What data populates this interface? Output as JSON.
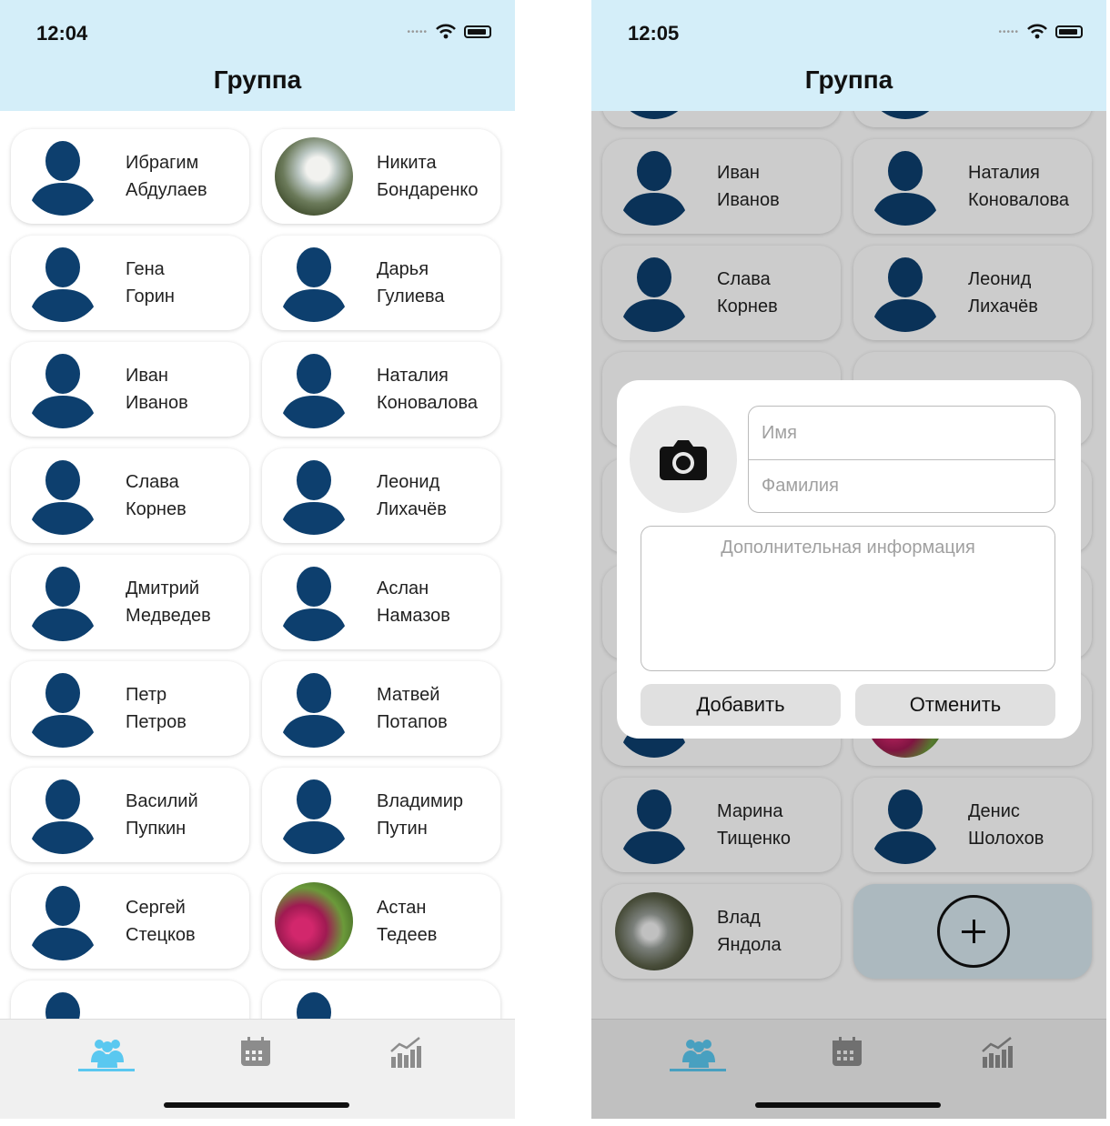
{
  "status": {
    "left_time": "12:04",
    "right_time": "12:05"
  },
  "header": {
    "title": "Группа"
  },
  "left_students": [
    {
      "first": "Ибрагим",
      "last": "Абдулаев",
      "avatar": "person-icon"
    },
    {
      "first": "Никита",
      "last": "Бондаренко",
      "avatar": "photo-waterfall"
    },
    {
      "first": "Гена",
      "last": "Горин",
      "avatar": "person-icon"
    },
    {
      "first": "Дарья",
      "last": "Гулиева",
      "avatar": "person-icon"
    },
    {
      "first": "Иван",
      "last": "Иванов",
      "avatar": "person-icon"
    },
    {
      "first": "Наталия",
      "last": "Коновалова",
      "avatar": "person-icon"
    },
    {
      "first": "Слава",
      "last": "Корнев",
      "avatar": "person-icon"
    },
    {
      "first": "Леонид",
      "last": "Лихачёв",
      "avatar": "person-icon"
    },
    {
      "first": "Дмитрий",
      "last": "Медведев",
      "avatar": "person-icon"
    },
    {
      "first": "Аслан",
      "last": "Намазов",
      "avatar": "person-icon"
    },
    {
      "first": "Петр",
      "last": "Петров",
      "avatar": "person-icon"
    },
    {
      "first": "Матвей",
      "last": "Потапов",
      "avatar": "person-icon"
    },
    {
      "first": "Василий",
      "last": "Пупкин",
      "avatar": "person-icon"
    },
    {
      "first": "Владимир",
      "last": "Путин",
      "avatar": "person-icon"
    },
    {
      "first": "Сергей",
      "last": "Стецков",
      "avatar": "person-icon"
    },
    {
      "first": "Астан",
      "last": "Тедеев",
      "avatar": "photo-flowers"
    },
    {
      "first": "Марина",
      "last": "",
      "avatar": "person-icon"
    },
    {
      "first": "Денис",
      "last": "",
      "avatar": "person-icon"
    }
  ],
  "right_students": [
    {
      "first": "",
      "last": "Горин",
      "avatar": "person-icon"
    },
    {
      "first": "",
      "last": "Гулиева",
      "avatar": "person-icon"
    },
    {
      "first": "Иван",
      "last": "Иванов",
      "avatar": "person-icon"
    },
    {
      "first": "Наталия",
      "last": "Коновалова",
      "avatar": "person-icon"
    },
    {
      "first": "Слава",
      "last": "Корнев",
      "avatar": "person-icon"
    },
    {
      "first": "Леонид",
      "last": "Лихачёв",
      "avatar": "person-icon"
    },
    {
      "first": "",
      "last": "",
      "avatar": "none"
    },
    {
      "first": "",
      "last": "",
      "avatar": "none"
    },
    {
      "first": "",
      "last": "",
      "avatar": "none"
    },
    {
      "first": "",
      "last": "",
      "avatar": "none"
    },
    {
      "first": "",
      "last": "",
      "avatar": "none"
    },
    {
      "first": "",
      "last": "",
      "avatar": "none"
    },
    {
      "first": "",
      "last": "Стецков",
      "avatar": "person-icon"
    },
    {
      "first": "",
      "last": "Тедеев",
      "avatar": "photo-flowers"
    },
    {
      "first": "Марина",
      "last": "Тищенко",
      "avatar": "person-icon"
    },
    {
      "first": "Денис",
      "last": "Шолохов",
      "avatar": "person-icon"
    },
    {
      "first": "Влад",
      "last": "Яндола",
      "avatar": "photo-stream"
    }
  ],
  "dialog": {
    "first_name_placeholder": "Имя",
    "last_name_placeholder": "Фамилия",
    "info_placeholder": "Дополнительная информация",
    "add_label": "Добавить",
    "cancel_label": "Отменить"
  },
  "tabs": [
    {
      "icon": "group-icon",
      "active": true
    },
    {
      "icon": "calendar-icon",
      "active": false
    },
    {
      "icon": "stats-icon",
      "active": false
    }
  ],
  "colors": {
    "header_bg": "#d4eef9",
    "avatar": "#0d3f6e",
    "tab_active": "#5ac8f0",
    "tab_inactive": "#8c8c8c"
  }
}
